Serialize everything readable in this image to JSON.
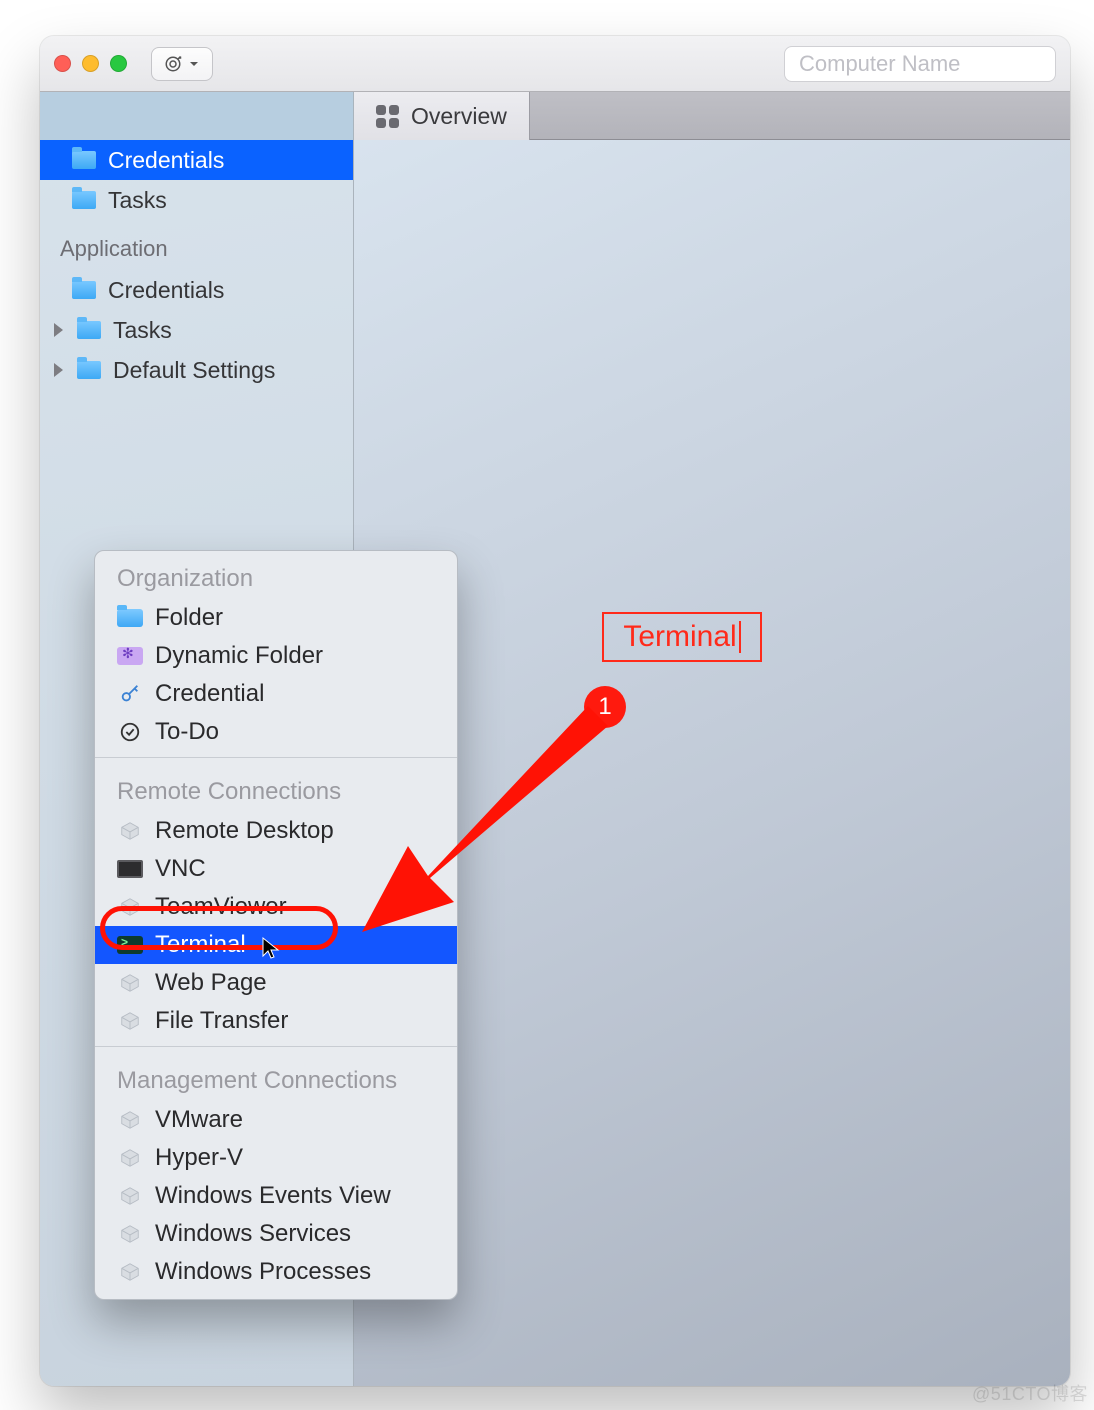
{
  "toolbar": {
    "search_placeholder": "Computer Name"
  },
  "tabs": {
    "overview": "Overview"
  },
  "sidebar": {
    "top_items": [
      {
        "label": "Credentials"
      },
      {
        "label": "Tasks"
      }
    ],
    "section_label": "Application",
    "app_items": [
      {
        "label": "Credentials",
        "has_children": false
      },
      {
        "label": "Tasks",
        "has_children": true
      },
      {
        "label": "Default Settings",
        "has_children": true
      }
    ]
  },
  "popup": {
    "sections": [
      {
        "label": "Organization",
        "items": [
          {
            "label": "Folder",
            "icon": "folder"
          },
          {
            "label": "Dynamic Folder",
            "icon": "dynamic-folder"
          },
          {
            "label": "Credential",
            "icon": "key"
          },
          {
            "label": "To-Do",
            "icon": "todo"
          }
        ]
      },
      {
        "label": "Remote Connections",
        "items": [
          {
            "label": "Remote Desktop",
            "icon": "box"
          },
          {
            "label": "VNC",
            "icon": "vnc"
          },
          {
            "label": "TeamViewer",
            "icon": "box"
          },
          {
            "label": "Terminal",
            "icon": "terminal",
            "selected": true
          },
          {
            "label": "Web Page",
            "icon": "box"
          },
          {
            "label": "File Transfer",
            "icon": "box"
          }
        ]
      },
      {
        "label": "Management Connections",
        "items": [
          {
            "label": "VMware",
            "icon": "box"
          },
          {
            "label": "Hyper-V",
            "icon": "box"
          },
          {
            "label": "Windows Events View",
            "icon": "box"
          },
          {
            "label": "Windows Services",
            "icon": "box"
          },
          {
            "label": "Windows Processes",
            "icon": "box"
          }
        ]
      }
    ]
  },
  "annotation": {
    "label": "Terminal",
    "badge": "1"
  },
  "watermark": "@51CTO博客"
}
